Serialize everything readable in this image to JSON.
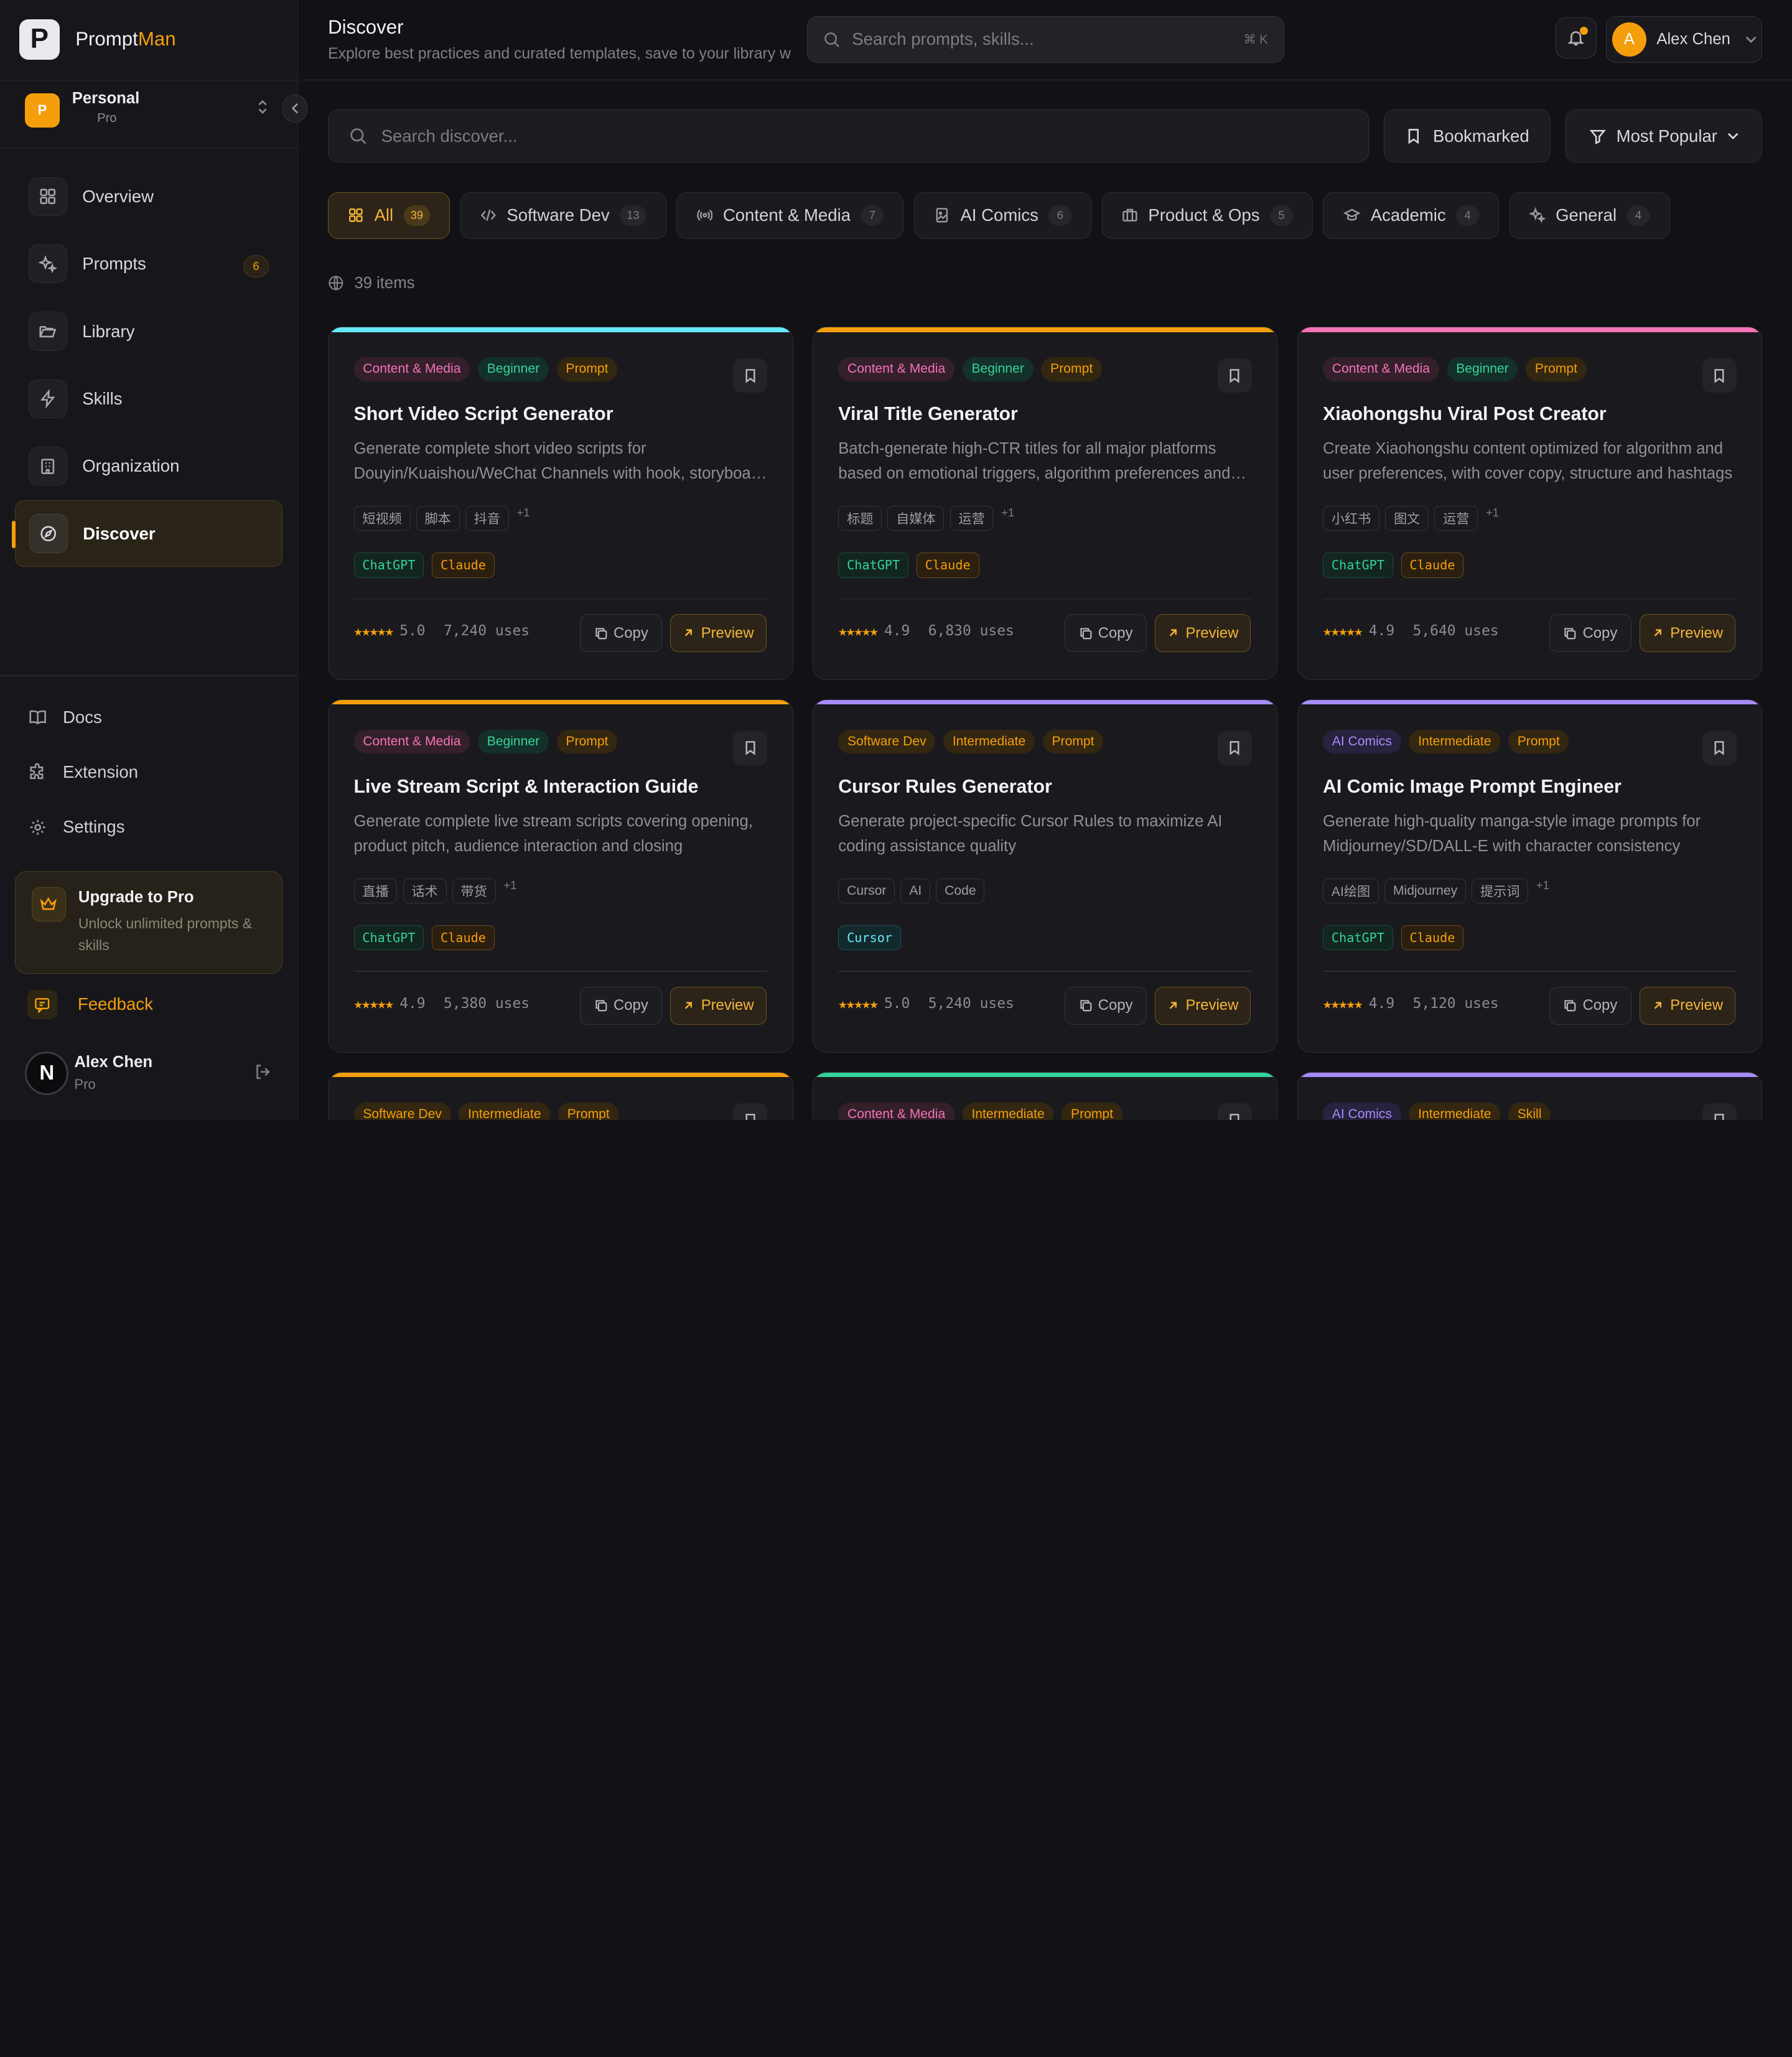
{
  "brand": {
    "name_main": "Prompt",
    "name_accent": "Man",
    "logo_letter": "P"
  },
  "workspace": {
    "avatar": "P",
    "name": "Personal",
    "plan": "Pro"
  },
  "nav": {
    "items": [
      {
        "label": "Overview",
        "icon": "grid-icon"
      },
      {
        "label": "Prompts",
        "icon": "sparkles-icon",
        "badge": "6"
      },
      {
        "label": "Library",
        "icon": "folder-open-icon"
      },
      {
        "label": "Skills",
        "icon": "zap-icon"
      },
      {
        "label": "Organization",
        "icon": "building-icon"
      },
      {
        "label": "Discover",
        "icon": "compass-icon",
        "active": true
      }
    ]
  },
  "secondary_nav": {
    "docs": "Docs",
    "extension": "Extension",
    "settings": "Settings"
  },
  "upgrade": {
    "title": "Upgrade to Pro",
    "description": "Unlock unlimited prompts & skills"
  },
  "feedback": {
    "label": "Feedback"
  },
  "sidebar_user": {
    "avatar": "N",
    "name": "Alex Chen",
    "plan": "Pro"
  },
  "header": {
    "title": "Discover",
    "subtitle": "Explore best practices and curated templates, save to your library w",
    "search_placeholder": "Search prompts, skills...",
    "search_shortcut": "⌘ K",
    "user_avatar": "A",
    "user_name": "Alex Chen"
  },
  "filters": {
    "search_placeholder": "Search discover...",
    "bookmarked_label": "Bookmarked",
    "sort_label": "Most Popular",
    "categories": [
      {
        "label": "All",
        "count": "39",
        "active": true
      },
      {
        "label": "Software Dev",
        "count": "13"
      },
      {
        "label": "Content & Media",
        "count": "7"
      },
      {
        "label": "AI Comics",
        "count": "6"
      },
      {
        "label": "Product & Ops",
        "count": "5"
      },
      {
        "label": "Academic",
        "count": "4"
      },
      {
        "label": "General",
        "count": "4"
      }
    ],
    "item_count": "39 items"
  },
  "labels": {
    "copy": "Copy",
    "preview": "Preview",
    "stars": "★★★★★"
  },
  "colors": {
    "accent": "#f59e0b",
    "cyan": "#67e8f9",
    "pink": "#f472b6",
    "purple": "#a78bfa",
    "green": "#34d399"
  },
  "cards": [
    {
      "bar": "#67e8f9",
      "category": "Content & Media",
      "cat_type": "content",
      "level": "Beginner",
      "lvl_type": "beginner",
      "kind": "Prompt",
      "title": "Short Video Script Generator",
      "description": "Generate complete short video scripts for Douyin/Kuaishou/WeChat Channels with hook, storyboard and call to action",
      "keywords": [
        "短视频",
        "脚本",
        "抖音"
      ],
      "more": "+1",
      "models": [
        {
          "name": "ChatGPT",
          "type": "gpt"
        },
        {
          "name": "Claude",
          "type": "claude"
        }
      ],
      "rating": "5.0",
      "uses": "7,240 uses"
    },
    {
      "bar": "#f59e0b",
      "category": "Content & Media",
      "cat_type": "content",
      "level": "Beginner",
      "lvl_type": "beginner",
      "kind": "Prompt",
      "title": "Viral Title Generator",
      "description": "Batch-generate high-CTR titles for all major platforms based on emotional triggers, algorithm preferences and trends",
      "keywords": [
        "标题",
        "自媒体",
        "运营"
      ],
      "more": "+1",
      "models": [
        {
          "name": "ChatGPT",
          "type": "gpt"
        },
        {
          "name": "Claude",
          "type": "claude"
        }
      ],
      "rating": "4.9",
      "uses": "6,830 uses"
    },
    {
      "bar": "#f472b6",
      "category": "Content & Media",
      "cat_type": "content",
      "level": "Beginner",
      "lvl_type": "beginner",
      "kind": "Prompt",
      "title": "Xiaohongshu Viral Post Creator",
      "description": "Create Xiaohongshu content optimized for algorithm and user preferences, with cover copy, structure and hashtags",
      "keywords": [
        "小红书",
        "图文",
        "运营"
      ],
      "more": "+1",
      "models": [
        {
          "name": "ChatGPT",
          "type": "gpt"
        },
        {
          "name": "Claude",
          "type": "claude"
        }
      ],
      "rating": "4.9",
      "uses": "5,640 uses"
    },
    {
      "bar": "#f59e0b",
      "category": "Content & Media",
      "cat_type": "content",
      "level": "Beginner",
      "lvl_type": "beginner",
      "kind": "Prompt",
      "title": "Live Stream Script & Interaction Guide",
      "description": "Generate complete live stream scripts covering opening, product pitch, audience interaction and closing",
      "keywords": [
        "直播",
        "话术",
        "带货"
      ],
      "more": "+1",
      "models": [
        {
          "name": "ChatGPT",
          "type": "gpt"
        },
        {
          "name": "Claude",
          "type": "claude"
        }
      ],
      "rating": "4.9",
      "uses": "5,380 uses"
    },
    {
      "bar": "#a78bfa",
      "category": "Software Dev",
      "cat_type": "software",
      "level": "Intermediate",
      "lvl_type": "intermediate",
      "kind": "Prompt",
      "title": "Cursor Rules Generator",
      "description": "Generate project-specific Cursor Rules to maximize AI coding assistance quality",
      "keywords": [
        "Cursor",
        "AI",
        "Code"
      ],
      "more": "",
      "models": [
        {
          "name": "Cursor",
          "type": "cursor"
        }
      ],
      "rating": "5.0",
      "uses": "5,240 uses"
    },
    {
      "bar": "#a78bfa",
      "category": "AI Comics",
      "cat_type": "comics",
      "level": "Intermediate",
      "lvl_type": "intermediate",
      "kind": "Prompt",
      "title": "AI Comic Image Prompt Engineer",
      "description": "Generate high-quality manga-style image prompts for Midjourney/SD/DALL-E with character consistency",
      "keywords": [
        "AI绘图",
        "Midjourney",
        "提示词"
      ],
      "more": "+1",
      "models": [
        {
          "name": "ChatGPT",
          "type": "gpt"
        },
        {
          "name": "Claude",
          "type": "claude"
        }
      ],
      "rating": "4.9",
      "uses": "5,120 uses"
    },
    {
      "bar": "#f59e0b",
      "category": "Software Dev",
      "cat_type": "software",
      "level": "Intermediate",
      "lvl_type": "intermediate",
      "kind": "Prompt",
      "title": "",
      "description": "",
      "keywords": [],
      "more": "",
      "models": [],
      "rating": "",
      "uses": ""
    },
    {
      "bar": "#34d399",
      "category": "Content & Media",
      "cat_type": "content",
      "level": "Intermediate",
      "lvl_type": "intermediate",
      "kind": "Prompt",
      "title": "",
      "description": "",
      "keywords": [],
      "more": "",
      "models": [],
      "rating": "",
      "uses": ""
    },
    {
      "bar": "#a78bfa",
      "category": "AI Comics",
      "cat_type": "comics",
      "level": "Intermediate",
      "lvl_type": "intermediate",
      "kind": "Skill",
      "title": "",
      "description": "",
      "keywords": [],
      "more": "",
      "models": [],
      "rating": "",
      "uses": ""
    }
  ]
}
